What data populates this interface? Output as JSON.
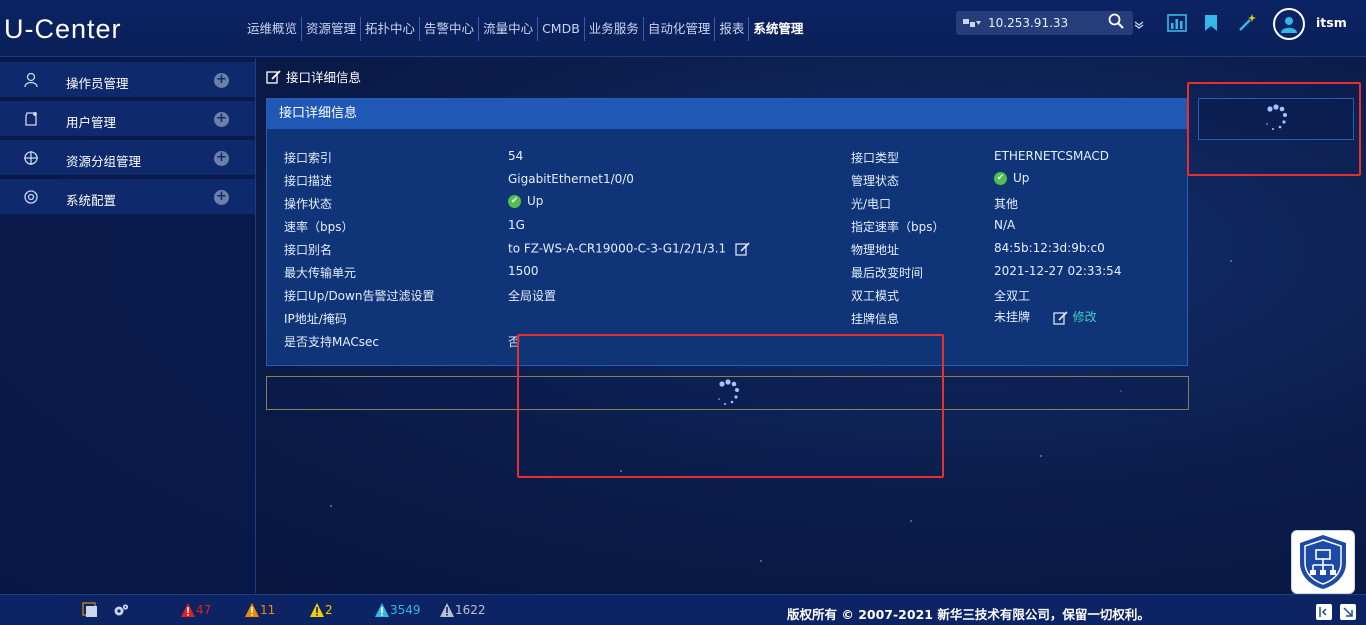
{
  "header": {
    "logo": "U-Center",
    "nav": [
      "运维概览",
      "资源管理",
      "拓扑中心",
      "告警中心",
      "流量中心",
      "CMDB",
      "业务服务",
      "自动化管理",
      "报表",
      "系统管理"
    ],
    "search_value": "10.253.91.33",
    "username": "itsm"
  },
  "sidebar": {
    "items": [
      {
        "label": "操作员管理",
        "icon": "user-icon"
      },
      {
        "label": "用户管理",
        "icon": "user-settings-icon"
      },
      {
        "label": "资源分组管理",
        "icon": "group-icon"
      },
      {
        "label": "系统配置",
        "icon": "gear-icon"
      }
    ]
  },
  "main": {
    "page_title": "接口详细信息",
    "panel_title": "接口详细信息",
    "left_fields": [
      {
        "label": "接口索引",
        "value": "54"
      },
      {
        "label": "接口描述",
        "value": "GigabitEthernet1/0/0"
      },
      {
        "label": "操作状态",
        "value": "Up"
      },
      {
        "label": "速率（bps）",
        "value": "1G"
      },
      {
        "label": "接口别名",
        "value": "to FZ-WS-A-CR19000-C-3-G1/2/1/3.1"
      },
      {
        "label": "最大传输单元",
        "value": "1500"
      },
      {
        "label": "接口Up/Down告警过滤设置",
        "value": "全局设置"
      },
      {
        "label": "IP地址/掩码",
        "value": ""
      },
      {
        "label": "是否支持MACsec",
        "value": "否"
      }
    ],
    "right_fields": [
      {
        "label": "接口类型",
        "value": "ETHERNETCSMACD"
      },
      {
        "label": "管理状态",
        "value": "Up"
      },
      {
        "label": "光/电口",
        "value": "其他"
      },
      {
        "label": "指定速率（bps）",
        "value": "N/A"
      },
      {
        "label": "物理地址",
        "value": "84:5b:12:3d:9b:c0"
      },
      {
        "label": "最后改变时间",
        "value": "2021-12-27 02:33:54"
      },
      {
        "label": "双工模式",
        "value": "全双工"
      },
      {
        "label": "挂牌信息",
        "value": "未挂牌"
      }
    ],
    "modify_label": "修改"
  },
  "footer": {
    "alarm_critical": "47",
    "alarm_major": "11",
    "alarm_minor": "2",
    "alarm_warning": "3549",
    "alarm_info": "1622",
    "copyright": "版权所有 © 2007-2021 新华三技术有限公司，保留一切权利。"
  },
  "colors": {
    "critical": "#e02020",
    "major": "#f08a00",
    "minor": "#f2d000",
    "warning": "#34b8e8",
    "info": "#b9c2d3",
    "accent": "#1f58b5"
  }
}
